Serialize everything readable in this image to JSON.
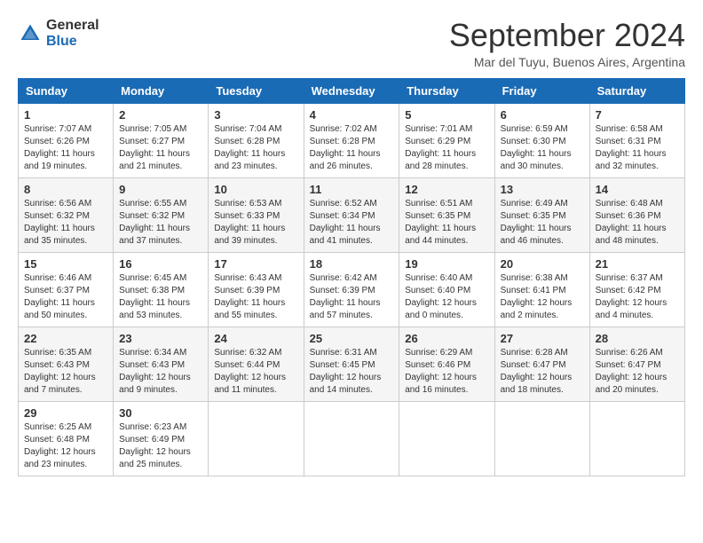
{
  "header": {
    "logo_general": "General",
    "logo_blue": "Blue",
    "month_title": "September 2024",
    "location": "Mar del Tuyu, Buenos Aires, Argentina"
  },
  "columns": [
    "Sunday",
    "Monday",
    "Tuesday",
    "Wednesday",
    "Thursday",
    "Friday",
    "Saturday"
  ],
  "weeks": [
    [
      {
        "day": "1",
        "info": "Sunrise: 7:07 AM\nSunset: 6:26 PM\nDaylight: 11 hours\nand 19 minutes."
      },
      {
        "day": "2",
        "info": "Sunrise: 7:05 AM\nSunset: 6:27 PM\nDaylight: 11 hours\nand 21 minutes."
      },
      {
        "day": "3",
        "info": "Sunrise: 7:04 AM\nSunset: 6:28 PM\nDaylight: 11 hours\nand 23 minutes."
      },
      {
        "day": "4",
        "info": "Sunrise: 7:02 AM\nSunset: 6:28 PM\nDaylight: 11 hours\nand 26 minutes."
      },
      {
        "day": "5",
        "info": "Sunrise: 7:01 AM\nSunset: 6:29 PM\nDaylight: 11 hours\nand 28 minutes."
      },
      {
        "day": "6",
        "info": "Sunrise: 6:59 AM\nSunset: 6:30 PM\nDaylight: 11 hours\nand 30 minutes."
      },
      {
        "day": "7",
        "info": "Sunrise: 6:58 AM\nSunset: 6:31 PM\nDaylight: 11 hours\nand 32 minutes."
      }
    ],
    [
      {
        "day": "8",
        "info": "Sunrise: 6:56 AM\nSunset: 6:32 PM\nDaylight: 11 hours\nand 35 minutes."
      },
      {
        "day": "9",
        "info": "Sunrise: 6:55 AM\nSunset: 6:32 PM\nDaylight: 11 hours\nand 37 minutes."
      },
      {
        "day": "10",
        "info": "Sunrise: 6:53 AM\nSunset: 6:33 PM\nDaylight: 11 hours\nand 39 minutes."
      },
      {
        "day": "11",
        "info": "Sunrise: 6:52 AM\nSunset: 6:34 PM\nDaylight: 11 hours\nand 41 minutes."
      },
      {
        "day": "12",
        "info": "Sunrise: 6:51 AM\nSunset: 6:35 PM\nDaylight: 11 hours\nand 44 minutes."
      },
      {
        "day": "13",
        "info": "Sunrise: 6:49 AM\nSunset: 6:35 PM\nDaylight: 11 hours\nand 46 minutes."
      },
      {
        "day": "14",
        "info": "Sunrise: 6:48 AM\nSunset: 6:36 PM\nDaylight: 11 hours\nand 48 minutes."
      }
    ],
    [
      {
        "day": "15",
        "info": "Sunrise: 6:46 AM\nSunset: 6:37 PM\nDaylight: 11 hours\nand 50 minutes."
      },
      {
        "day": "16",
        "info": "Sunrise: 6:45 AM\nSunset: 6:38 PM\nDaylight: 11 hours\nand 53 minutes."
      },
      {
        "day": "17",
        "info": "Sunrise: 6:43 AM\nSunset: 6:39 PM\nDaylight: 11 hours\nand 55 minutes."
      },
      {
        "day": "18",
        "info": "Sunrise: 6:42 AM\nSunset: 6:39 PM\nDaylight: 11 hours\nand 57 minutes."
      },
      {
        "day": "19",
        "info": "Sunrise: 6:40 AM\nSunset: 6:40 PM\nDaylight: 12 hours\nand 0 minutes."
      },
      {
        "day": "20",
        "info": "Sunrise: 6:38 AM\nSunset: 6:41 PM\nDaylight: 12 hours\nand 2 minutes."
      },
      {
        "day": "21",
        "info": "Sunrise: 6:37 AM\nSunset: 6:42 PM\nDaylight: 12 hours\nand 4 minutes."
      }
    ],
    [
      {
        "day": "22",
        "info": "Sunrise: 6:35 AM\nSunset: 6:43 PM\nDaylight: 12 hours\nand 7 minutes."
      },
      {
        "day": "23",
        "info": "Sunrise: 6:34 AM\nSunset: 6:43 PM\nDaylight: 12 hours\nand 9 minutes."
      },
      {
        "day": "24",
        "info": "Sunrise: 6:32 AM\nSunset: 6:44 PM\nDaylight: 12 hours\nand 11 minutes."
      },
      {
        "day": "25",
        "info": "Sunrise: 6:31 AM\nSunset: 6:45 PM\nDaylight: 12 hours\nand 14 minutes."
      },
      {
        "day": "26",
        "info": "Sunrise: 6:29 AM\nSunset: 6:46 PM\nDaylight: 12 hours\nand 16 minutes."
      },
      {
        "day": "27",
        "info": "Sunrise: 6:28 AM\nSunset: 6:47 PM\nDaylight: 12 hours\nand 18 minutes."
      },
      {
        "day": "28",
        "info": "Sunrise: 6:26 AM\nSunset: 6:47 PM\nDaylight: 12 hours\nand 20 minutes."
      }
    ],
    [
      {
        "day": "29",
        "info": "Sunrise: 6:25 AM\nSunset: 6:48 PM\nDaylight: 12 hours\nand 23 minutes."
      },
      {
        "day": "30",
        "info": "Sunrise: 6:23 AM\nSunset: 6:49 PM\nDaylight: 12 hours\nand 25 minutes."
      },
      {
        "day": "",
        "info": ""
      },
      {
        "day": "",
        "info": ""
      },
      {
        "day": "",
        "info": ""
      },
      {
        "day": "",
        "info": ""
      },
      {
        "day": "",
        "info": ""
      }
    ]
  ]
}
